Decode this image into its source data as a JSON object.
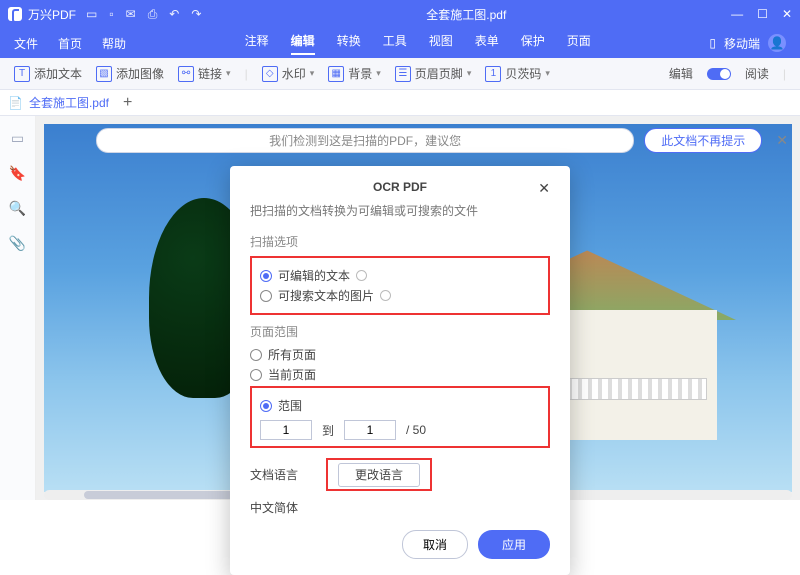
{
  "titlebar": {
    "app": "万兴PDF",
    "doc": "全套施工图.pdf"
  },
  "menu": {
    "file": "文件",
    "home": "首页",
    "help": "帮助",
    "tabs": [
      "注释",
      "编辑",
      "转换",
      "工具",
      "视图",
      "表单",
      "保护",
      "页面"
    ],
    "active": 1,
    "mobile": "移动端"
  },
  "toolbar": {
    "addText": "添加文本",
    "addImage": "添加图像",
    "link": "链接",
    "watermark": "水印",
    "background": "背景",
    "headerFooter": "页眉页脚",
    "bates": "贝茨码",
    "edit": "编辑",
    "read": "阅读"
  },
  "filetab": {
    "name": "全套施工图.pdf"
  },
  "notice": {
    "text": "我们检测到这是扫描的PDF，建议您",
    "dismiss": "此文档不再提示"
  },
  "dialog": {
    "title": "OCR PDF",
    "subtitle": "把扫描的文档转换为可编辑或可搜索的文件",
    "scanSection": "扫描选项",
    "opt1": "可编辑的文本",
    "opt2": "可搜索文本的图片",
    "rangeSection": "页面范围",
    "allPages": "所有页面",
    "currentPage": "当前页面",
    "range": "范围",
    "from": "1",
    "toLabel": "到",
    "to": "1",
    "total": "/ 50",
    "langLabel": "文档语言",
    "changeLang": "更改语言",
    "langValue": "中文简体",
    "cancel": "取消",
    "apply": "应用"
  }
}
